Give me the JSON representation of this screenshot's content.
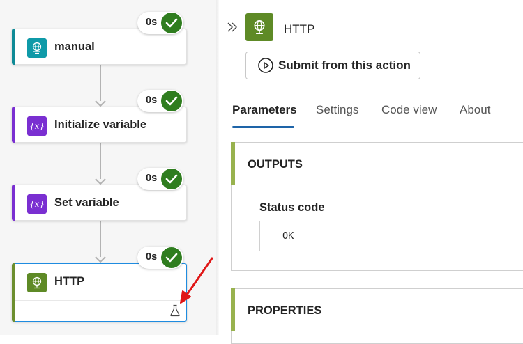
{
  "workflow": {
    "nodes": [
      {
        "label": "manual",
        "duration": "0s",
        "icon": "globe-request-icon",
        "accent": "#0f8a96"
      },
      {
        "label": "Initialize variable",
        "duration": "0s",
        "icon": "variable-icon",
        "accent": "#7a2fd1"
      },
      {
        "label": "Set variable",
        "duration": "0s",
        "icon": "variable-icon",
        "accent": "#7a2fd1"
      },
      {
        "label": "HTTP",
        "duration": "0s",
        "icon": "globe-http-icon",
        "accent": "#6c8e2e",
        "selected": true
      }
    ],
    "variable_glyph": "{x}"
  },
  "panel": {
    "title": "HTTP",
    "submit_label": "Submit from this action",
    "tabs": [
      "Parameters",
      "Settings",
      "Code view",
      "About"
    ],
    "active_tab": "Parameters",
    "outputs": {
      "title": "OUTPUTS",
      "status_label": "Status code",
      "status_value": "OK"
    },
    "properties": {
      "title": "PROPERTIES"
    }
  },
  "colors": {
    "success": "#2f7d1f",
    "selected_border": "#1f8ce0",
    "tab_underline": "#1e64a8",
    "annotation_arrow": "#e01616"
  }
}
